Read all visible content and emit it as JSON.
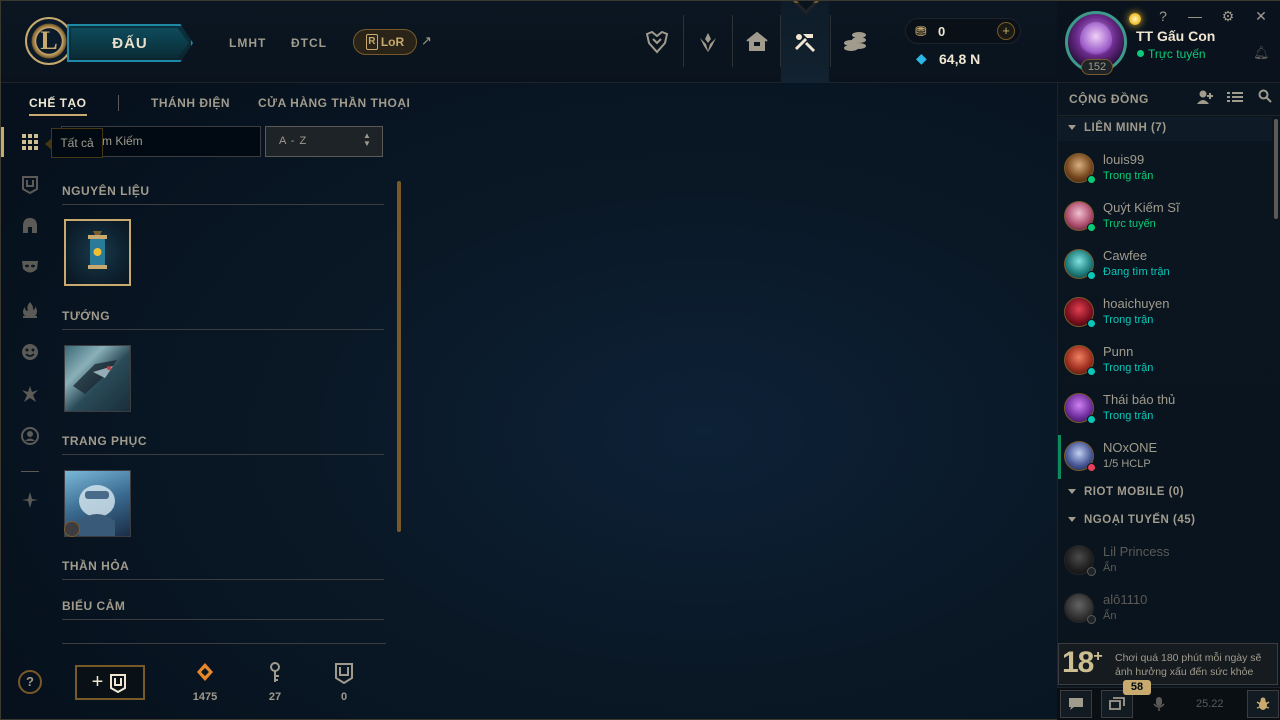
{
  "topbar": {
    "play_label": "ĐẤU",
    "nav": [
      "LMHT",
      "ĐTCL"
    ],
    "lor_label": "LoR",
    "ext_arrow": "↗",
    "rp_value": "0",
    "be_value": "64,8 N",
    "plus": "+"
  },
  "profile": {
    "name": "TT Gấu Con",
    "status": "Trực tuyến",
    "level": "152",
    "help": "?",
    "minimize": "—",
    "settings": "⚙",
    "close": "✕"
  },
  "loot": {
    "tabs": [
      "CHẾ TẠO",
      "THÁNH ĐIỆN",
      "CỬA HÀNG THẦN THOẠI"
    ],
    "tooltip": "Tất cả",
    "search_text": "m Kiếm",
    "sort": "A - Z",
    "sections": [
      "NGUYÊN LIỆU",
      "TƯỚNG",
      "TRANG PHỤC",
      "THẦN HỎA",
      "BIỂU CẢM"
    ],
    "help": "?",
    "craft_plus": "+",
    "materials": [
      {
        "icon": "orange-essence-icon",
        "value": "1475"
      },
      {
        "icon": "key-fragment-icon",
        "value": "27"
      },
      {
        "icon": "chest-icon",
        "value": "0"
      }
    ]
  },
  "social": {
    "title": "CỘNG ĐỒNG",
    "groups": {
      "g1": "LIÊN MINH (7)",
      "g2": "RIOT MOBILE (0)",
      "g3": "NGOẠI TUYẾN (45)"
    },
    "friends": [
      {
        "name": "louis99",
        "status": "Trong trận",
        "status_color": "#0acb79"
      },
      {
        "name": "Quýt Kiếm Sĩ",
        "status": "Trực tuyến",
        "status_color": "#0acb79"
      },
      {
        "name": "Cawfee",
        "status": "Đang tìm trận",
        "status_color": "#0ac8b9"
      },
      {
        "name": "hoaichuyen",
        "status": "Trong trận",
        "status_color": "#0ac8b9"
      },
      {
        "name": "Punn",
        "status": "Trong trận",
        "status_color": "#0ac8b9"
      },
      {
        "name": "Thái báo thủ",
        "status": "Trong trận",
        "status_color": "#0ac8b9"
      },
      {
        "name": "NOxONE",
        "status": "1/5 HCLP",
        "status_color": "#a09b8c"
      }
    ],
    "offline": [
      {
        "name": "Lil Princess",
        "status": "Ẩn"
      },
      {
        "name": "alô1110",
        "status": "Ẩn"
      }
    ],
    "warning_age": "18",
    "warning_plus": "+",
    "warning_text": "Chơi quá 180 phút mỗi ngày sẽ ảnh hưởng xấu đến sức khỏe",
    "badge": "58",
    "version": "25.22"
  },
  "colors": {
    "gold": "#c8aa6e",
    "online": "#0acb79",
    "in_game": "#0ac8b9"
  }
}
